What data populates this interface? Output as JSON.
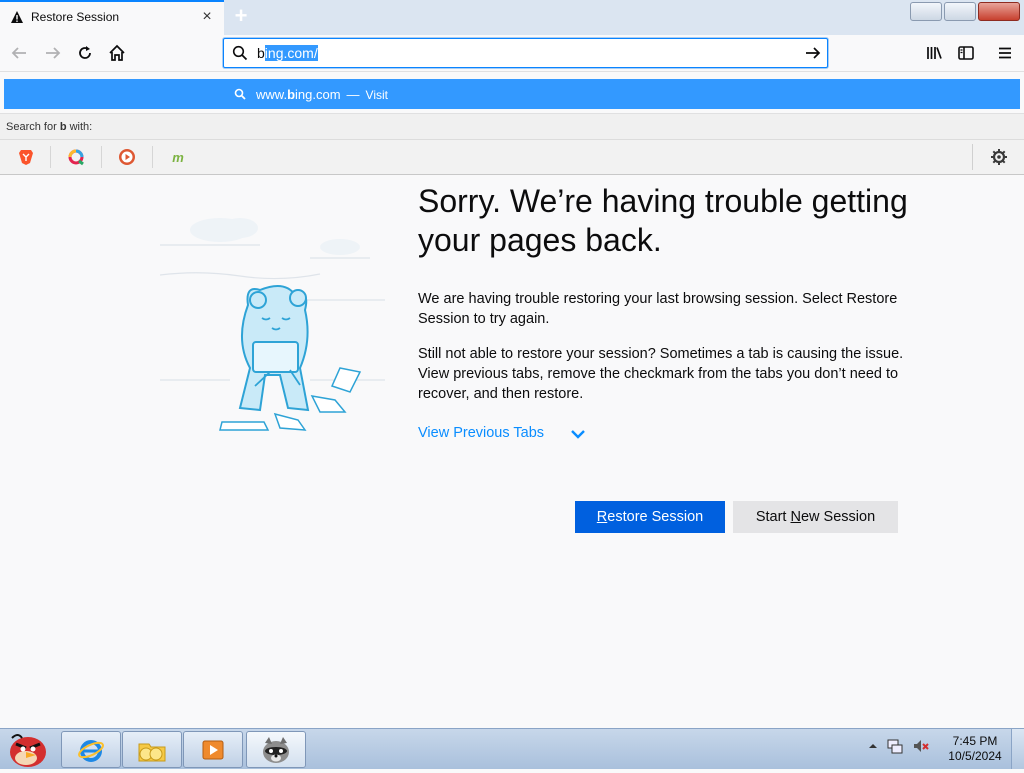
{
  "tab": {
    "title": "Restore Session"
  },
  "urlbar": {
    "value_before": "b",
    "value_selected": "ing.com/"
  },
  "suggestion": {
    "url_prefix": "www.",
    "url_bold": "b",
    "url_suffix": "ing.com",
    "separator": "—",
    "action": "Visit"
  },
  "search_for": {
    "prefix": "Search for ",
    "term": "b",
    "suffix": " with:"
  },
  "engines": [
    "brave-icon",
    "qwant-icon",
    "duckduckgo-icon",
    "mojeek-icon"
  ],
  "page": {
    "title": "Sorry. We’re having trouble getting your pages back.",
    "paragraph1": "We are having trouble restoring your last browsing session. Select Restore Session to try again.",
    "paragraph2": "Still not able to restore your session? Sometimes a tab is causing the issue. View previous tabs, remove the checkmark from the tabs you don’t need to recover, and then restore.",
    "view_previous_tabs": "View Previous Tabs",
    "restore_button": {
      "before": "",
      "accel": "R",
      "after": "estore Session"
    },
    "new_session_button": {
      "before": "Start ",
      "accel": "N",
      "after": "ew Session"
    }
  },
  "taskbar": {
    "apps": [
      "angry-birds-start-icon",
      "internet-explorer-icon",
      "file-explorer-icon",
      "media-player-icon",
      "raccoon-app-icon"
    ],
    "time": "7:45 PM",
    "date": "10/5/2024"
  },
  "colors": {
    "accent": "#0a84ff",
    "primary_button": "#0060df",
    "link": "#0a8dff",
    "selection": "#3399ff"
  }
}
